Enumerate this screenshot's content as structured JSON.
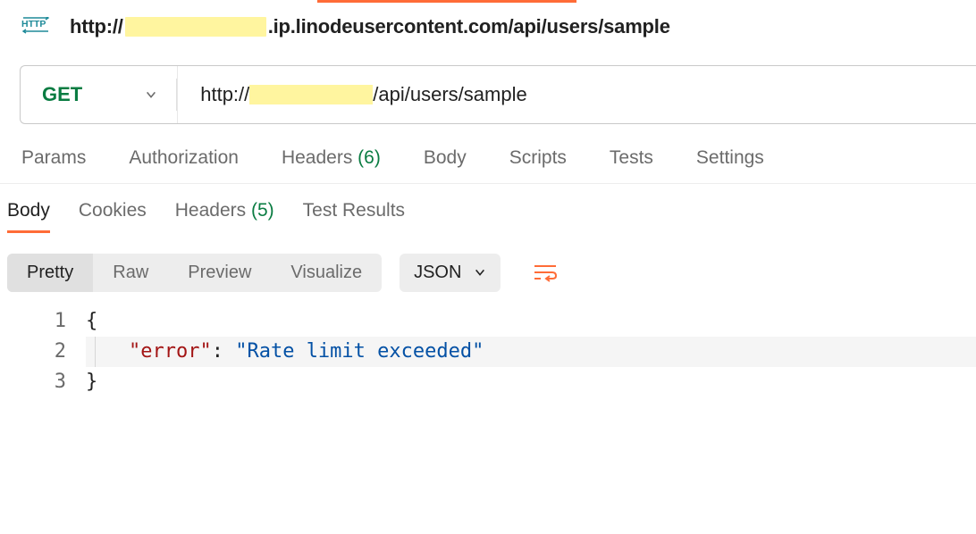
{
  "title": {
    "prefix": "http://",
    "suffix": ".ip.linodeusercontent.com/api/users/sample"
  },
  "request": {
    "method": "GET",
    "url_prefix": "http://",
    "url_suffix": "/api/users/sample"
  },
  "requestTabs": {
    "params": "Params",
    "authorization": "Authorization",
    "headers_label": "Headers",
    "headers_count": "(6)",
    "body": "Body",
    "scripts": "Scripts",
    "tests": "Tests",
    "settings": "Settings"
  },
  "responseTabs": {
    "body": "Body",
    "cookies": "Cookies",
    "headers_label": "Headers",
    "headers_count": "(5)",
    "testResults": "Test Results"
  },
  "viewModes": {
    "pretty": "Pretty",
    "raw": "Raw",
    "preview": "Preview",
    "visualize": "Visualize",
    "format": "JSON"
  },
  "code": {
    "line1": "{",
    "line2_key": "\"error\"",
    "line2_colon": ": ",
    "line2_value": "\"Rate limit exceeded\"",
    "line3": "}",
    "ln1": "1",
    "ln2": "2",
    "ln3": "3"
  }
}
